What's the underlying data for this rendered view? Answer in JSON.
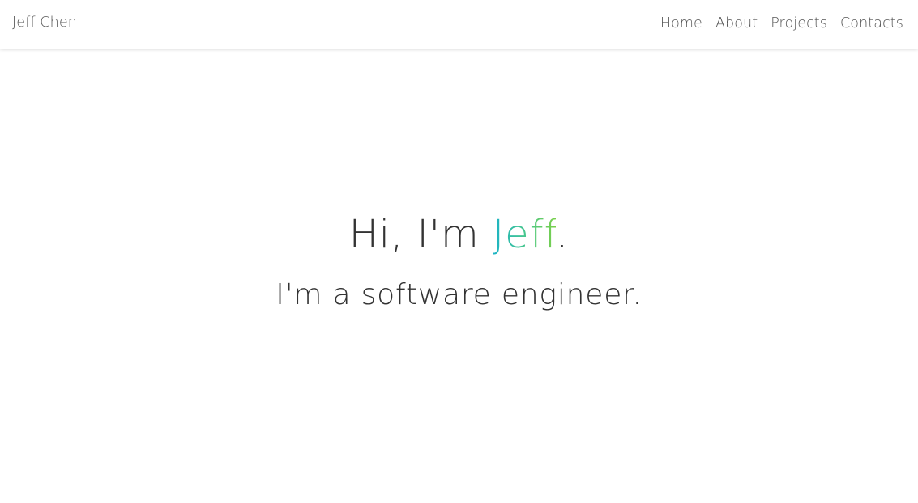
{
  "navbar": {
    "brand": "Jeff Chen",
    "links": [
      {
        "label": "Home"
      },
      {
        "label": "About"
      },
      {
        "label": "Projects"
      },
      {
        "label": "Contacts"
      }
    ]
  },
  "hero": {
    "greeting_prefix": "Hi, I'm ",
    "name": "Jeff",
    "greeting_suffix": ".",
    "subtitle": "I'm a software engineer."
  },
  "colors": {
    "name_gradient_start": "#1ab3c6",
    "name_gradient_end": "#7ad04a",
    "text": "#333333",
    "nav_text": "#555555"
  }
}
